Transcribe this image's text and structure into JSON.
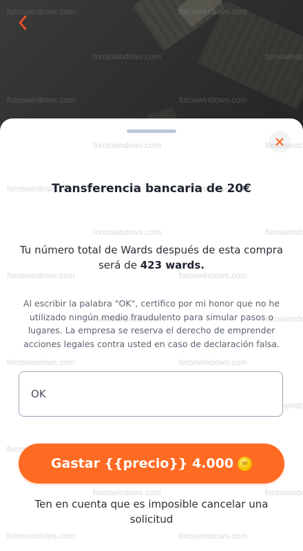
{
  "watermark_text": "foroswindows.com",
  "colors": {
    "accent": "#ff6b22",
    "coin": "#f5c400",
    "input_border": "#9aa4b8",
    "handle": "#b9c6d8"
  },
  "header": {
    "back_icon": "chevron-left-icon"
  },
  "modal": {
    "close_icon": "close-icon",
    "title": "Transferencia bancaria de 20€",
    "summary_prefix": "Tu número total de Wards después de esta compra será de",
    "summary_amount": "423 wards.",
    "disclaimer": "Al escribir la palabra \"OK\", certifico por mi honor que no he utilizado ningún medio fraudulento para simular pasos o lugares. La empresa se reserva el derecho de emprender acciones legales contra usted en caso de declaración falsa.",
    "input_value": "OK",
    "spend_button_label": "Gastar {{precio}} 4.000",
    "coin_icon": "coin-icon",
    "coin_letter": "W",
    "note": "Ten en cuenta que es imposible cancelar una solicitud"
  }
}
